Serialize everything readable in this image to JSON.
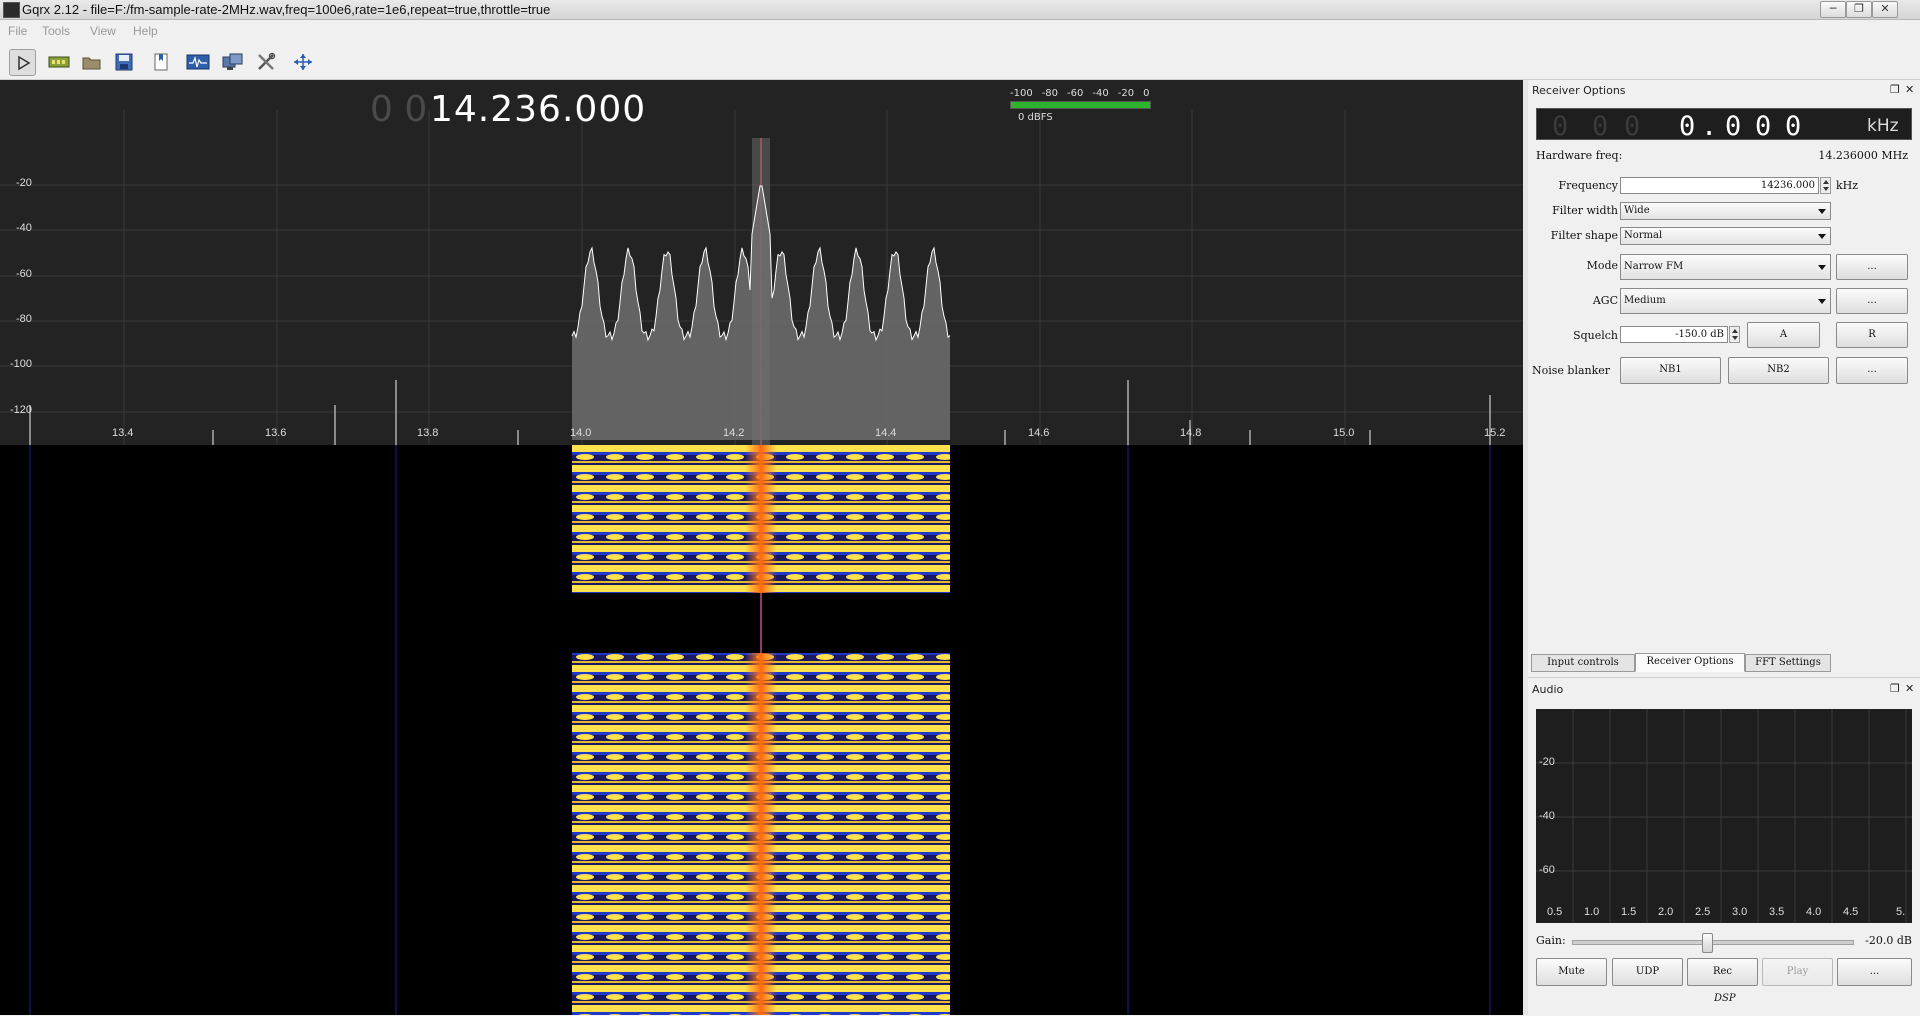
{
  "window": {
    "title": "Gqrx 2.12 - file=F:/fm-sample-rate-2MHz.wav,freq=100e6,rate=1e6,repeat=true,throttle=true",
    "minimize": "─",
    "restore": "❐",
    "close": "✕"
  },
  "menu": {
    "file": "File",
    "tools": "Tools",
    "view": "View",
    "help": "Help"
  },
  "toolbar": {
    "icons": [
      "play-icon",
      "hardware-icon",
      "open-icon",
      "save-icon",
      "bookmark-icon",
      "dsp-icon",
      "remote-control-icon",
      "tools-icon",
      "adjust-icon"
    ]
  },
  "fft": {
    "freq_dim": "0 0",
    "freq_main": "14.236.000",
    "db_scale": [
      "-100",
      "-80",
      "-60",
      "-40",
      "-20",
      "0"
    ],
    "dbfs": "0 dBFS",
    "y_labels": [
      "-20",
      "-40",
      "-60",
      "-80",
      "-100",
      "-120"
    ],
    "x_labels": [
      "13.4",
      "13.6",
      "13.8",
      "14.0",
      "14.2",
      "14.4",
      "14.6",
      "14.8",
      "15.0",
      "15.2"
    ],
    "colors": {
      "background": "#232323",
      "trace": "#ffffff",
      "waterfall_hot": "#ffd23a",
      "waterfall_peak": "#ff7a1a",
      "waterfall_cold": "#1b2fb0",
      "demod_line": "#c44b8a",
      "level_bar": "#2cb52c"
    }
  },
  "receiver": {
    "dock_title": "Receiver Options",
    "lcd_digits": [
      "0",
      "0",
      "0",
      "0",
      ".",
      "0",
      "0",
      "0"
    ],
    "lcd_unit": "kHz",
    "hw_freq_label": "Hardware freq:",
    "hw_freq_value": "14.236000 MHz",
    "frequency_label": "Frequency",
    "frequency_value": "14236.000",
    "frequency_unit": "kHz",
    "filter_width_label": "Filter width",
    "filter_width_value": "Wide",
    "filter_shape_label": "Filter shape",
    "filter_shape_value": "Normal",
    "mode_label": "Mode",
    "mode_value": "Narrow FM",
    "agc_label": "AGC",
    "agc_value": "Medium",
    "squelch_label": "Squelch",
    "squelch_value": "-150.0 dB",
    "squelch_a": "A",
    "squelch_r": "R",
    "nb_label": "Noise blanker",
    "nb1": "NB1",
    "nb2": "NB2",
    "more": "..."
  },
  "tabs": [
    "Input controls",
    "Receiver Options",
    "FFT Settings"
  ],
  "audio": {
    "dock_title": "Audio",
    "y_labels": [
      "-20",
      "-40",
      "-60"
    ],
    "x_labels": [
      "0.5",
      "1.0",
      "1.5",
      "2.0",
      "2.5",
      "3.0",
      "3.5",
      "4.0",
      "4.5",
      "5."
    ],
    "gain_label": "Gain:",
    "gain_value": "-20.0 dB",
    "mute": "Mute",
    "udp": "UDP",
    "rec": "Rec",
    "play": "Play",
    "more": "...",
    "dsp": "DSP"
  }
}
